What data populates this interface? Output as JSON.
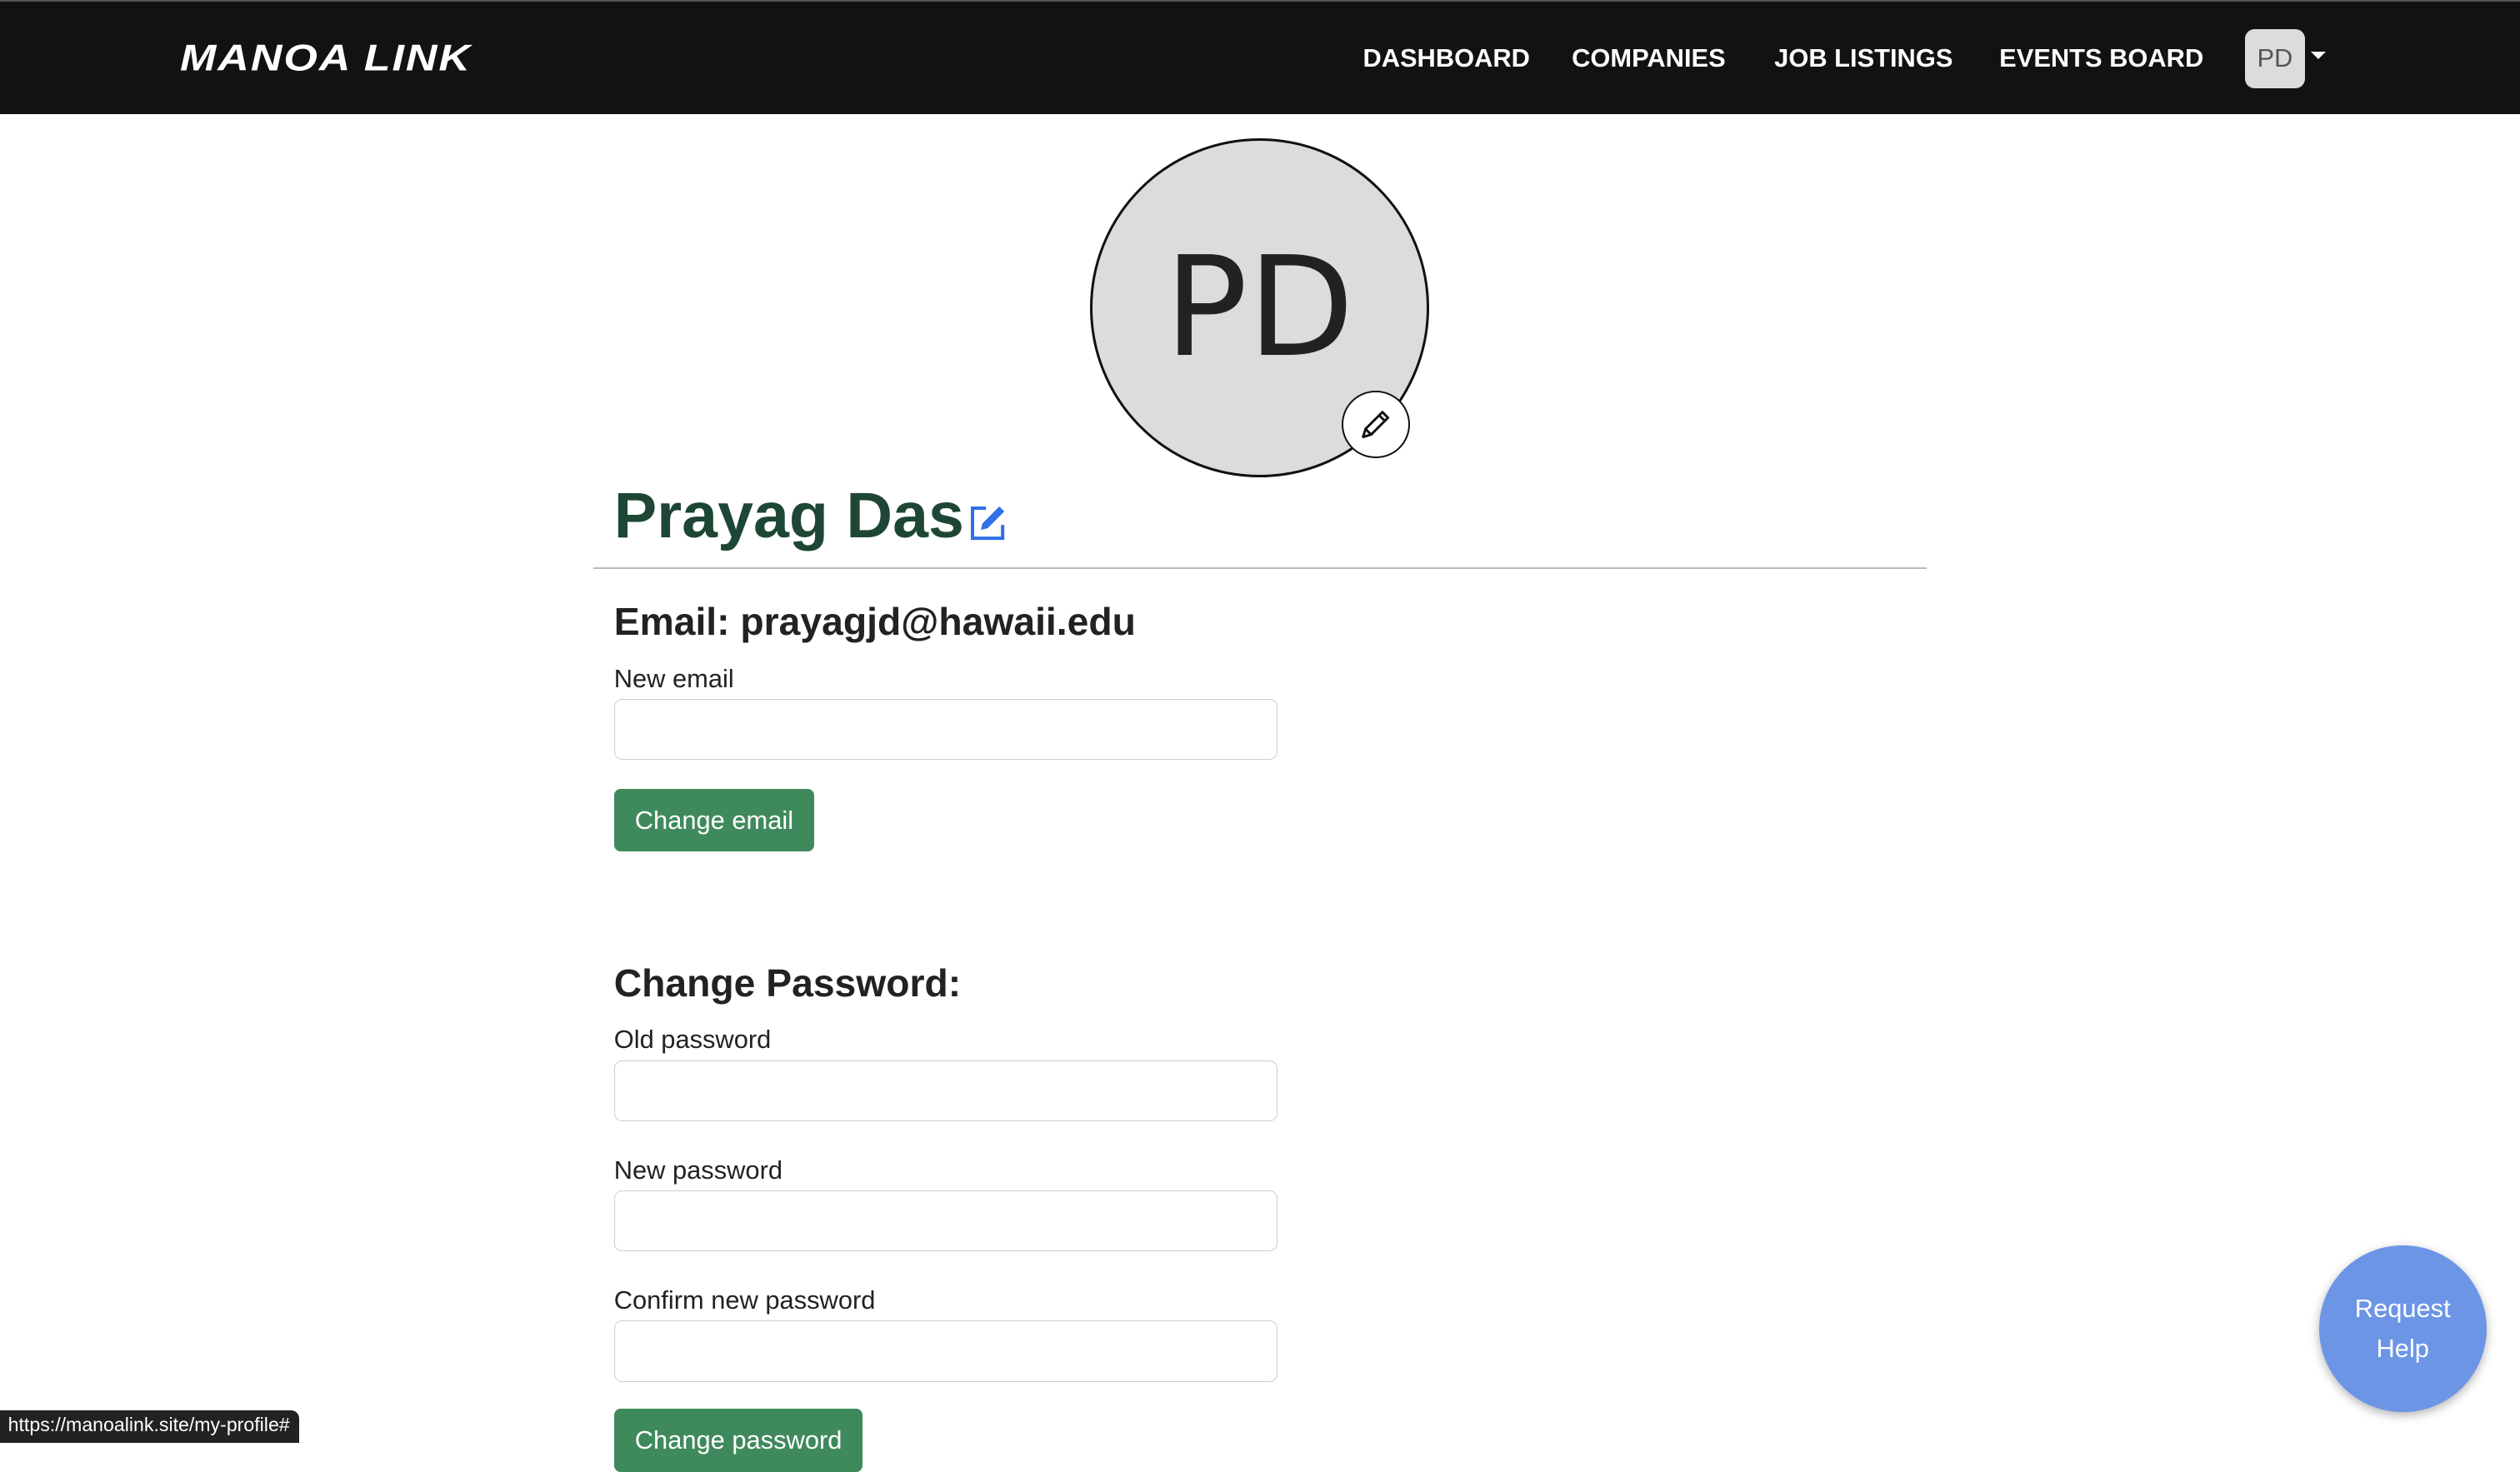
{
  "nav": {
    "logo": "MANOA LINK",
    "links": [
      "DASHBOARD",
      "COMPANIES",
      "JOB LISTINGS",
      "EVENTS BOARD"
    ],
    "user_initials": "PD"
  },
  "profile": {
    "initials": "PD",
    "name": "Prayag Das"
  },
  "email_section": {
    "heading": "Email: prayagjd@hawaii.edu",
    "new_email_label": "New email",
    "new_email_value": "",
    "button": "Change email"
  },
  "password_section": {
    "heading": "Change Password:",
    "old_label": "Old password",
    "new_label": "New password",
    "confirm_label": "Confirm new password",
    "button": "Change password"
  },
  "status_url": "https://manoalink.site/my-profile#",
  "help_button": "Request Help",
  "colors": {
    "nav": "#121212",
    "button": "#3f8a5c",
    "name": "#1e4634",
    "help": "#6d95e6",
    "edit_icon": "#2f6fe8"
  }
}
